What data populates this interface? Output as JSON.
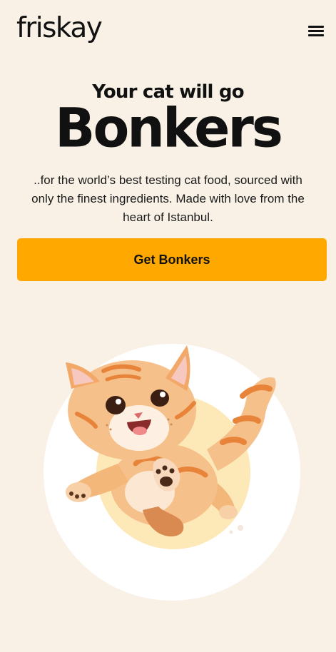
{
  "header": {
    "logo": "friskay",
    "menu_icon": "hamburger-menu-icon"
  },
  "hero": {
    "subtitle": "Your cat will go",
    "title": "Bonkers",
    "description": "..for the world’s best testing cat food, sourced with only the finest ingredients. Made with love from the heart of Istanbul.",
    "cta_label": "Get Bonkers"
  },
  "colors": {
    "background": "#f9f1e6",
    "accent": "#ffa800",
    "text": "#111111",
    "circle": "#ffffff",
    "inner_circle": "#fde9b8",
    "cat_orange": "#f0a050"
  }
}
